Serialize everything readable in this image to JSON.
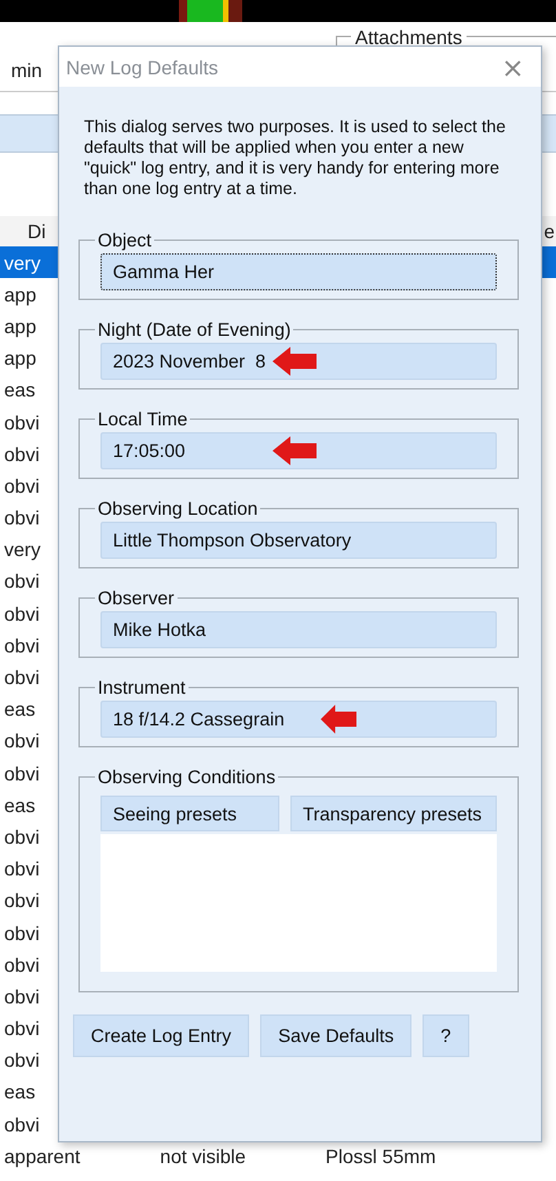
{
  "background": {
    "group_label": "Attachments",
    "field_label": "min",
    "header": {
      "column_1": "Di",
      "column_2": "e"
    },
    "rows": [
      {
        "text": "very",
        "selected": true
      },
      {
        "text": "app",
        "selected": false
      },
      {
        "text": "app",
        "selected": false
      },
      {
        "text": "app",
        "selected": false
      },
      {
        "text": "eas",
        "selected": false
      },
      {
        "text": "obvi",
        "selected": false
      },
      {
        "text": "obvi",
        "selected": false
      },
      {
        "text": "obvi",
        "selected": false
      },
      {
        "text": "obvi",
        "selected": false
      },
      {
        "text": "very",
        "selected": false
      },
      {
        "text": "obvi",
        "selected": false
      },
      {
        "text": "obvi",
        "selected": false
      },
      {
        "text": "obvi",
        "selected": false
      },
      {
        "text": "obvi",
        "selected": false
      },
      {
        "text": "eas",
        "selected": false
      },
      {
        "text": "obvi",
        "selected": false
      },
      {
        "text": "obvi",
        "selected": false
      },
      {
        "text": "eas",
        "selected": false
      },
      {
        "text": "obvi",
        "selected": false
      },
      {
        "text": "obvi",
        "selected": false
      },
      {
        "text": "obvi",
        "selected": false
      },
      {
        "text": "obvi",
        "selected": false
      },
      {
        "text": "obvi",
        "selected": false
      },
      {
        "text": "obvi",
        "selected": false
      },
      {
        "text": "obvi",
        "selected": false
      },
      {
        "text": "obvi",
        "selected": false
      },
      {
        "text": "eas",
        "selected": false
      },
      {
        "text": "obvi",
        "selected": false
      }
    ],
    "last_row": [
      "apparent",
      "not visible",
      "Plossl 55mm"
    ]
  },
  "dialog": {
    "title": "New Log Defaults",
    "close": "×",
    "description": "This dialog serves two purposes. It is used to select the defaults that will be applied when you enter a new \"quick\" log entry, and it is very handy for entering more than one log entry at a time.",
    "fields": [
      {
        "label": "Object",
        "value": "Gamma Her",
        "focused": true,
        "marked": false
      },
      {
        "label": "Night (Date of Evening)",
        "value": "2023 November  8",
        "focused": false,
        "marked": true
      },
      {
        "label": "Local Time",
        "value": "17:05:00",
        "focused": false,
        "marked": true
      },
      {
        "label": "Observing Location",
        "value": "Little Thompson Observatory",
        "focused": false,
        "marked": false
      },
      {
        "label": "Observer",
        "value": "Mike Hotka",
        "focused": false,
        "marked": false
      },
      {
        "label": "Instrument",
        "value": "18 f/14.2 Cassegrain",
        "focused": false,
        "marked": true
      }
    ],
    "conditions": {
      "label": "Observing Conditions",
      "buttons": [
        "Seeing presets",
        "Transparency presets"
      ]
    },
    "buttons": [
      "Create Log Entry",
      "Save Defaults",
      "?"
    ]
  }
}
